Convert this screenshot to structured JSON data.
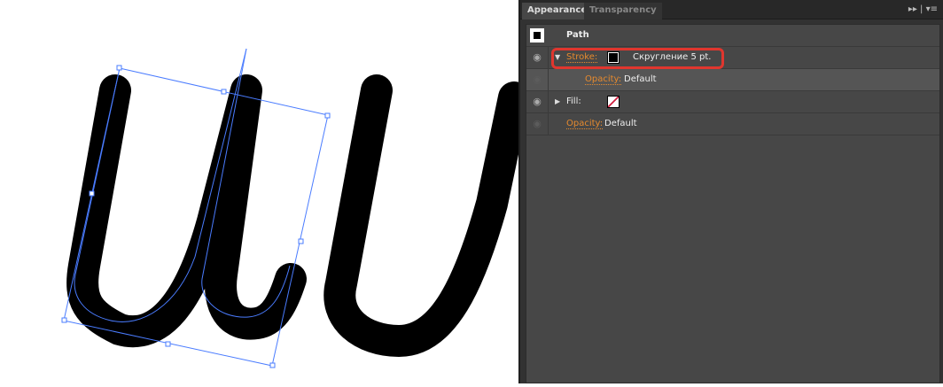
{
  "tabs": [
    "Appearance",
    "Transparency"
  ],
  "panel": {
    "title": "Path",
    "stroke": {
      "label": "Stroke:",
      "value": "Скругление 5 pt."
    },
    "stroke_opacity": {
      "label": "Opacity:",
      "value": "Default"
    },
    "fill": {
      "label": "Fill:"
    },
    "opacity": {
      "label": "Opacity:",
      "value": "Default"
    }
  },
  "colors": {
    "highlight": "#e0362e",
    "accent": "#e68a2e",
    "selection": "#4a7cff"
  }
}
